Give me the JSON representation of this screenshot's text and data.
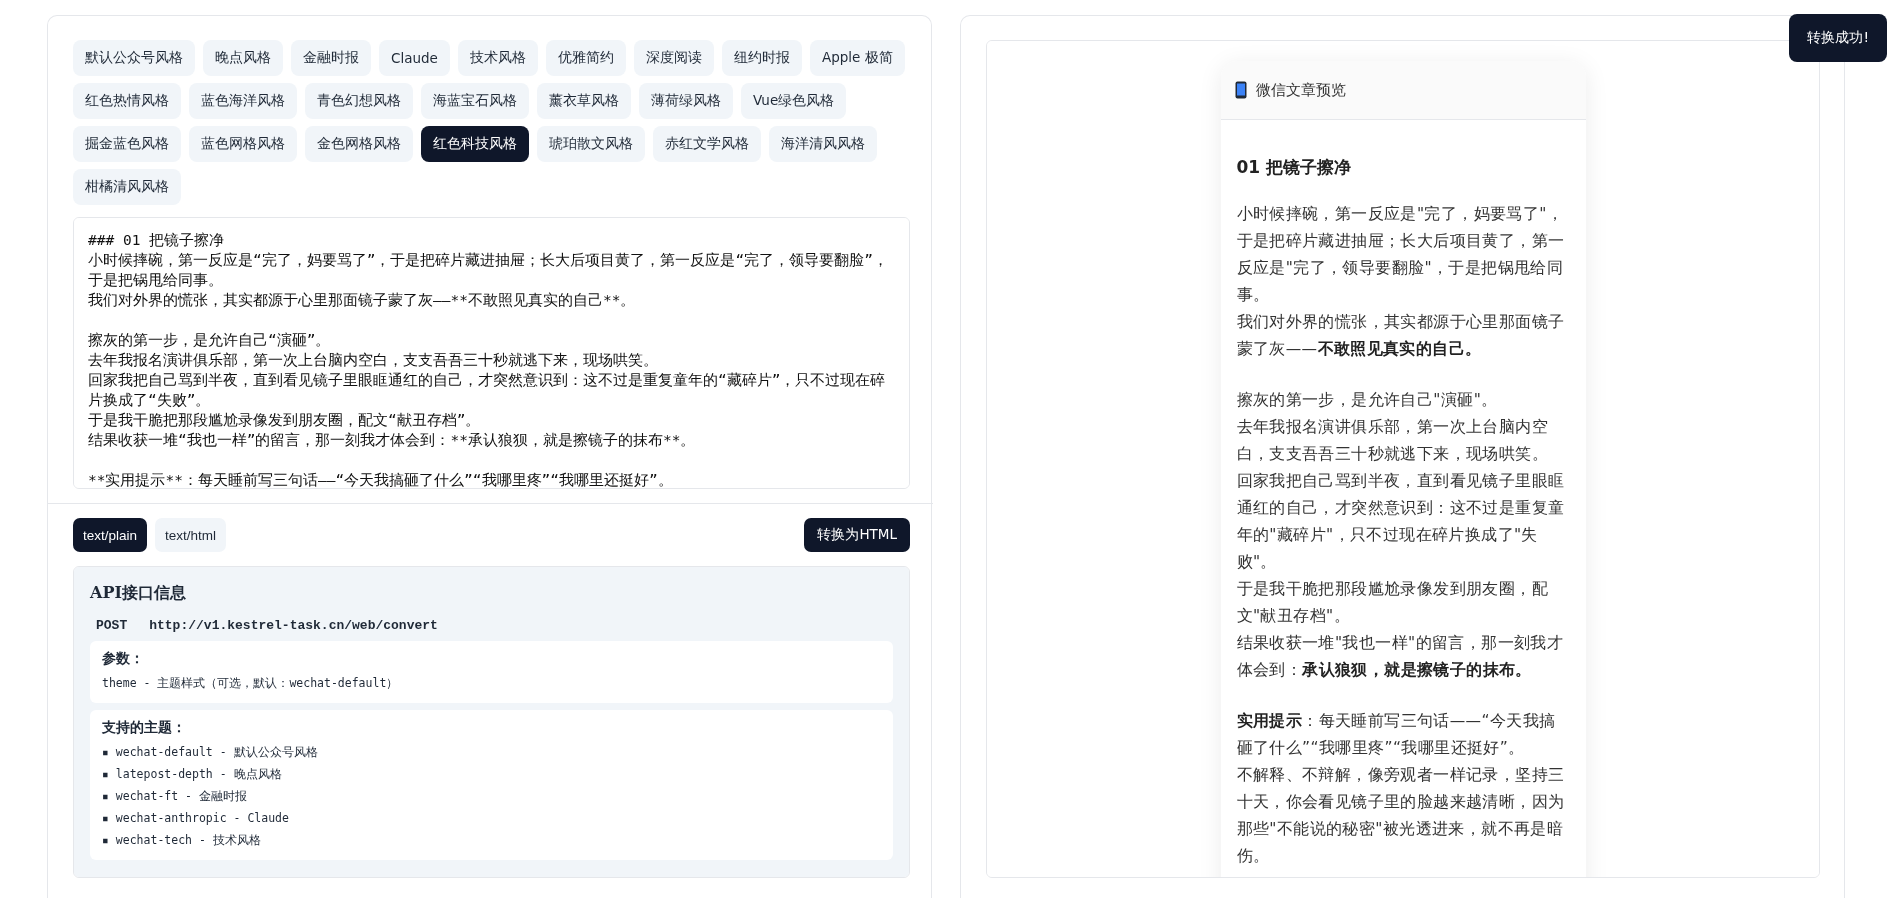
{
  "themes": [
    {
      "label": "默认公众号风格",
      "selected": false
    },
    {
      "label": "晚点风格",
      "selected": false
    },
    {
      "label": "金融时报",
      "selected": false
    },
    {
      "label": "Claude",
      "selected": false
    },
    {
      "label": "技术风格",
      "selected": false
    },
    {
      "label": "优雅简约",
      "selected": false
    },
    {
      "label": "深度阅读",
      "selected": false
    },
    {
      "label": "纽约时报",
      "selected": false
    },
    {
      "label": "Apple 极简",
      "selected": false
    },
    {
      "label": "红色热情风格",
      "selected": false
    },
    {
      "label": "蓝色海洋风格",
      "selected": false
    },
    {
      "label": "青色幻想风格",
      "selected": false
    },
    {
      "label": "海蓝宝石风格",
      "selected": false
    },
    {
      "label": "薰衣草风格",
      "selected": false
    },
    {
      "label": "薄荷绿风格",
      "selected": false
    },
    {
      "label": "Vue绿色风格",
      "selected": false
    },
    {
      "label": "掘金蓝色风格",
      "selected": false
    },
    {
      "label": "蓝色网格风格",
      "selected": false
    },
    {
      "label": "金色网格风格",
      "selected": false
    },
    {
      "label": "红色科技风格",
      "selected": true
    },
    {
      "label": "琥珀散文风格",
      "selected": false
    },
    {
      "label": "赤红文学风格",
      "selected": false
    },
    {
      "label": "海洋清风风格",
      "selected": false
    },
    {
      "label": "柑橘清风风格",
      "selected": false
    }
  ],
  "editor": {
    "blocks": [
      [
        "### 01 把镜子擦净",
        "小时候摔碗，第一反应是“完了，妈要骂了”，于是把碎片藏进抽屉；长大后项目黄了，第一反应是“完了，领导要翻脸”，于是把锅甩给同事。",
        "我们对外界的慌张，其实都源于心里那面镜子蒙了灰——**不敢照见真实的自己**。"
      ],
      [
        "擦灰的第一步，是允许自己“演砸”。",
        "去年我报名演讲俱乐部，第一次上台脑内空白，支支吾吾三十秒就逃下来，现场哄笑。",
        "回家我把自己骂到半夜，直到看见镜子里眼眶通红的自己，才突然意识到：这不过是重复童年的“藏碎片”，只不过现在碎片换成了“失败”。",
        "于是我干脆把那段尴尬录像发到朋友圈，配文“献丑存档”。",
        "结果收获一堆“我也一样”的留言，那一刻我才体会到：**承认狼狈，就是擦镜子的抹布**。"
      ],
      [
        "**实用提示**：每天睡前写三句话——“今天我搞砸了什么”“我哪里疼”“我哪里还挺好”。"
      ]
    ]
  },
  "format_tabs": [
    {
      "label": "text/plain",
      "selected": true
    },
    {
      "label": "text/html",
      "selected": false
    }
  ],
  "convert_button": "转换为HTML",
  "api_info": {
    "title": "API接口信息",
    "method": "POST",
    "url": "http://v1.kestrel-task.cn/web/convert",
    "params": {
      "heading": "参数：",
      "lines": [
        "theme - 主题样式（可选，默认：wechat-default）"
      ]
    },
    "supported_themes": {
      "heading": "支持的主题：",
      "items": [
        "▪ wechat-default - 默认公众号风格",
        "▪ latepost-depth - 晚点风格",
        "▪ wechat-ft - 金融时报",
        "▪ wechat-anthropic - Claude",
        "▪ wechat-tech - 技术风格"
      ]
    }
  },
  "preview": {
    "header": "微信文章预览",
    "heading": "01 把镜子擦净",
    "paragraphs": [
      [
        "小时候摔碗，第一反应是\"完了，妈要骂了\"，于是把碎片藏进抽屉；长大后项目黄了，第一反应是\"完了，领导要翻脸\"，于是把锅甩给同事。",
        "我们对外界的慌张，其实都源于心里那面镜子蒙了灰——**不敢照见真实的自己。**"
      ],
      [
        "擦灰的第一步，是允许自己\"演砸\"。",
        "去年我报名演讲俱乐部，第一次上台脑内空白，支支吾吾三十秒就逃下来，现场哄笑。",
        "回家我把自己骂到半夜，直到看见镜子里眼眶通红的自己，才突然意识到：这不过是重复童年的\"藏碎片\"，只不过现在碎片换成了\"失败\"。",
        "于是我干脆把那段尴尬录像发到朋友圈，配文\"献丑存档\"。",
        "结果收获一堆\"我也一样\"的留言，那一刻我才体会到：**承认狼狈，就是擦镜子的抹布。**"
      ],
      [
        "**实用提示**：每天睡前写三句话——“今天我搞砸了什么”“我哪里疼”“我哪里还挺好”。",
        "不解释、不辩解，像旁观者一样记录，坚持三十天，你会看见镜子里的脸越来越清晰，因为那些\"不能说的秘密\"被光透进来，就不再是暗伤。"
      ]
    ]
  },
  "toast": "转换成功!"
}
